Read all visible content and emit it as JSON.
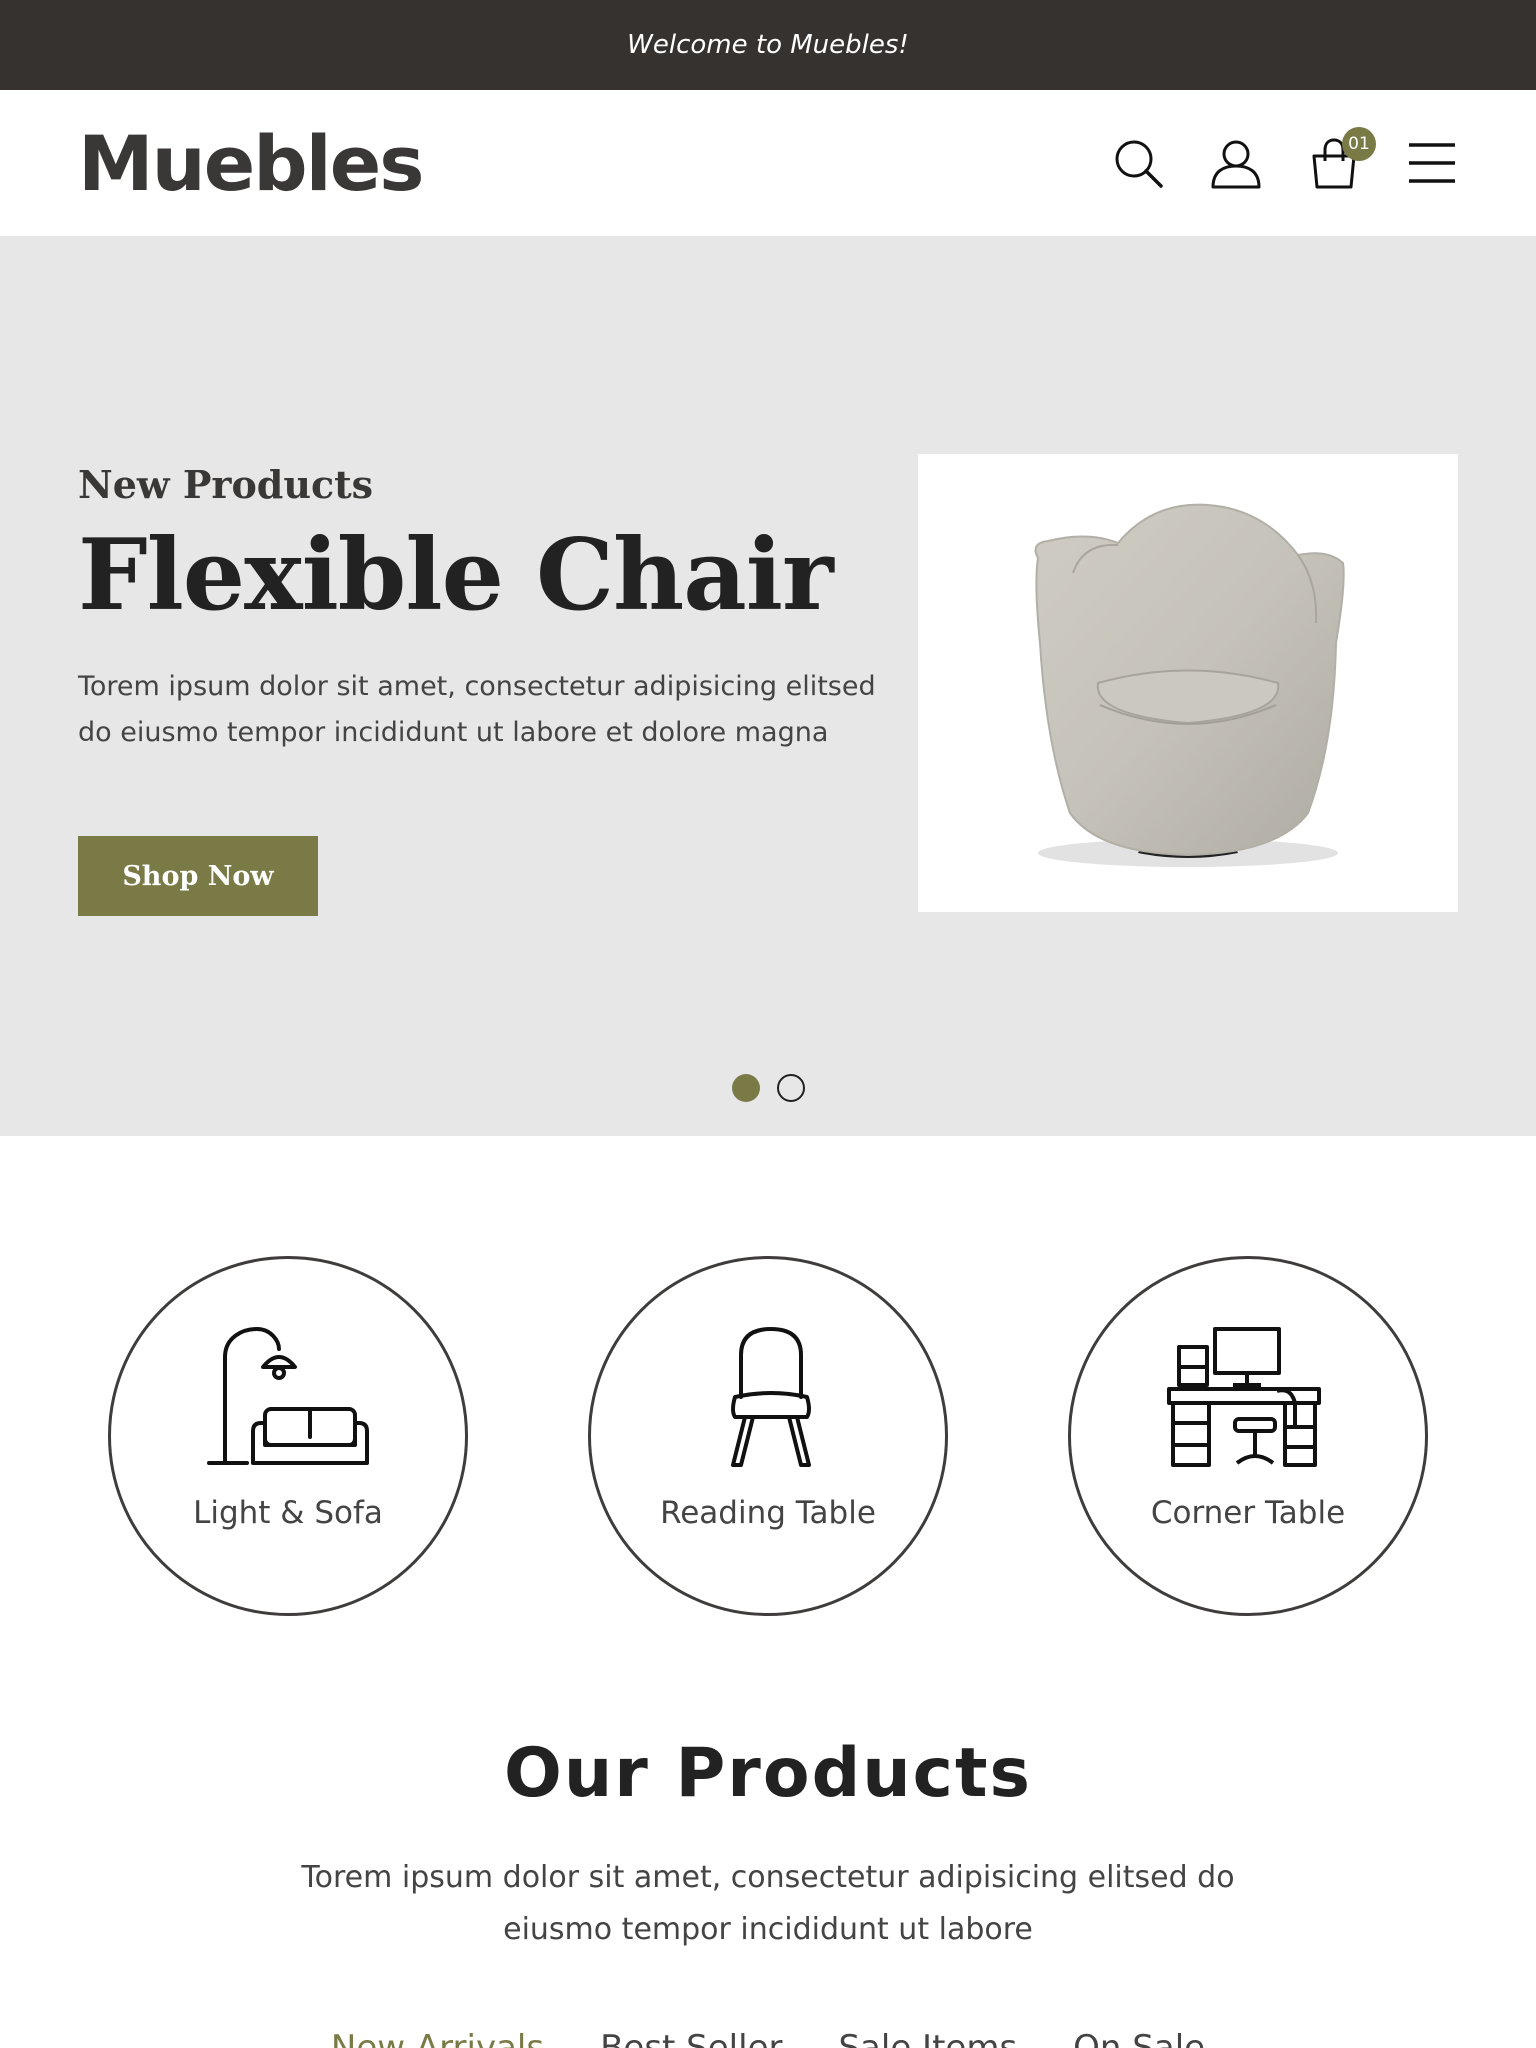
{
  "topbar": {
    "welcome": "Welcome to Muebles!"
  },
  "header": {
    "logo": "Muebles",
    "cart_count": "01",
    "icons": [
      "search-icon",
      "user-icon",
      "cart-icon",
      "menu-icon"
    ]
  },
  "hero": {
    "subtitle": "New Products",
    "title": "Flexible Chair",
    "text": "Torem ipsum dolor sit amet, consectetur adipisicing elitsed do eiusmo tempor incididunt ut labore et dolore magna",
    "button": "Shop Now",
    "image": "armchair-image",
    "slides": 2,
    "active_slide": 1
  },
  "categories": [
    {
      "label": "Light & Sofa",
      "icon": "lamp-sofa-icon"
    },
    {
      "label": "Reading Table",
      "icon": "chair-icon"
    },
    {
      "label": "Corner Table",
      "icon": "desk-computer-icon"
    }
  ],
  "products": {
    "title": "Our Products",
    "text": "Torem ipsum dolor sit amet, consectetur adipisicing elitsed do eiusmo tempor incididunt ut labore",
    "tabs": [
      "New Arrivals",
      "Best Seller",
      "Sale Items",
      "On Sale"
    ]
  },
  "colors": {
    "accent": "#7a7a47",
    "topbar": "#363230",
    "hero_bg": "#e7e7e7",
    "text_dark": "#222222"
  }
}
